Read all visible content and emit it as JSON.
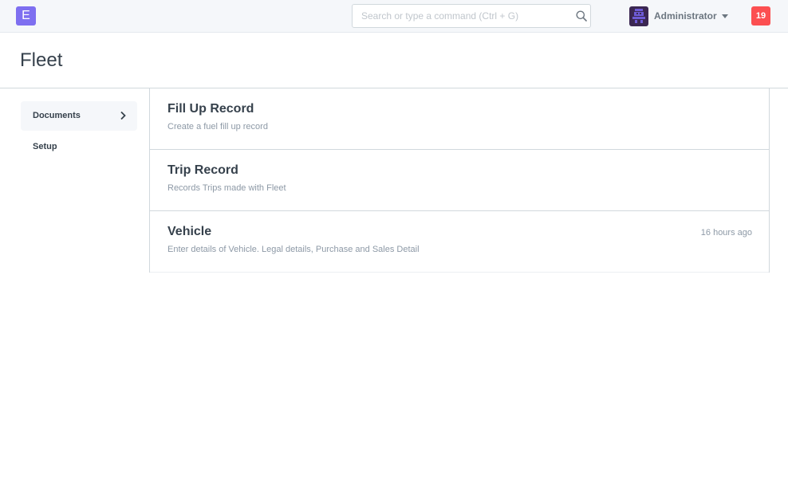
{
  "app": {
    "logo_letter": "E",
    "accent": "#7e6ff0"
  },
  "search": {
    "placeholder": "Search or type a command (Ctrl + G)",
    "value": "",
    "icon": "search-icon"
  },
  "user": {
    "name": "Administrator",
    "avatar": "robot-avatar-icon"
  },
  "notifications": {
    "count": "19",
    "color": "#fc4f51"
  },
  "page": {
    "title": "Fleet"
  },
  "sidebar": {
    "items": [
      {
        "label": "Documents",
        "active": true
      },
      {
        "label": "Setup",
        "active": false
      }
    ]
  },
  "doctypes": [
    {
      "title": "Fill Up Record",
      "description": "Create a fuel fill up record",
      "timestamp": ""
    },
    {
      "title": "Trip Record",
      "description": "Records Trips made with Fleet",
      "timestamp": ""
    },
    {
      "title": "Vehicle",
      "description": "Enter details of Vehicle. Legal details, Purchase and Sales Detail",
      "timestamp": "16 hours ago"
    }
  ]
}
